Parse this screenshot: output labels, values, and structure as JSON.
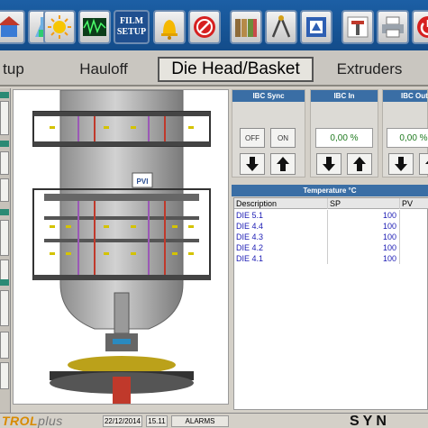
{
  "toolbar": {
    "film_setup_label_line1": "FILM",
    "film_setup_label_line2": "SETUP",
    "icons": [
      "home-icon",
      "flask-icon",
      "sun-icon",
      "oscilloscope-icon",
      "film-setup-button",
      "bell-icon",
      "no-entry-icon",
      "binders-icon",
      "compass-icon",
      "badge-icon",
      "tools-icon",
      "printer-icon",
      "power-icon"
    ]
  },
  "tabs": [
    {
      "label": "tup"
    },
    {
      "label": "Hauloff"
    },
    {
      "label": "Die Head/Basket"
    },
    {
      "label": "Extruders"
    }
  ],
  "drawing": {
    "label_badge": "PVI"
  },
  "ibc_sync": {
    "title": "IBC Sync",
    "off_label": "OFF",
    "on_label": "ON"
  },
  "ibc_in": {
    "title": "IBC In",
    "value": "0,00 %"
  },
  "ibc_out": {
    "title": "IBC Out",
    "value": "0,00 %"
  },
  "temperature": {
    "title": "Temperature °C",
    "columns": [
      "Description",
      "SP",
      "PV"
    ],
    "rows": [
      {
        "description": "DIE 5.1",
        "sp": "100",
        "pv": ""
      },
      {
        "description": "DIE 4.4",
        "sp": "100",
        "pv": ""
      },
      {
        "description": "DIE 4.3",
        "sp": "100",
        "pv": ""
      },
      {
        "description": "DIE 4.2",
        "sp": "100",
        "pv": ""
      },
      {
        "description": "DIE 4.1",
        "sp": "100",
        "pv": ""
      }
    ]
  },
  "status": {
    "brand_main": "TROL",
    "brand_plus": "plus",
    "date": "22/12/2014",
    "time": "15.11",
    "alarms": "ALARMS",
    "logo": "SYN"
  },
  "colors": {
    "toolbar_blue": "#1c5fa5",
    "panel_header_blue": "#3a6ea5",
    "value_green": "#1f7a1f",
    "table_text_blue": "#1b1bb4",
    "brand_orange": "#d88a00"
  }
}
